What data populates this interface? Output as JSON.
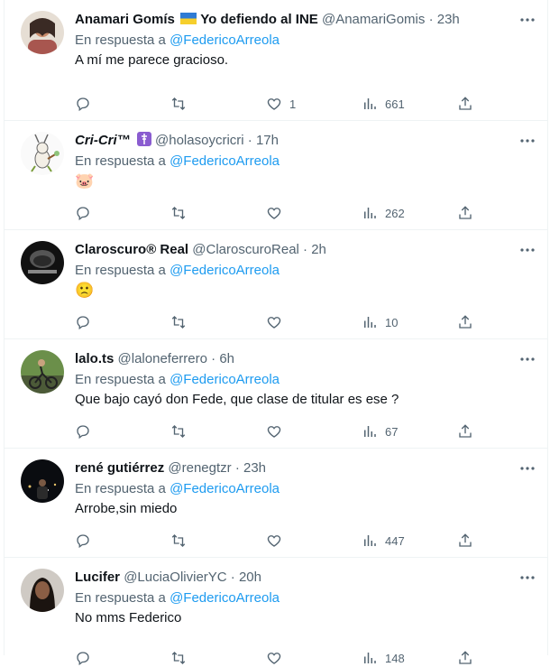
{
  "reply_prefix": "En respuesta a",
  "reply_handle": "@FedericoArreola",
  "tweets": [
    {
      "name": "Anamari Gomís",
      "name_suffix": "Yo defiendo al INE",
      "handle": "@AnamariGomis",
      "time": "23h",
      "text": "A mí me parece gracioso.",
      "likes": "1",
      "views": "661"
    },
    {
      "name": "Cri-Cri™",
      "handle": "@holasoycricri",
      "time": "17h",
      "text": "🐷",
      "likes": "",
      "views": "262"
    },
    {
      "name": "Claroscuro® Real",
      "handle": "@ClaroscuroReal",
      "time": "2h",
      "text": "🙁",
      "likes": "",
      "views": "10"
    },
    {
      "name": "lalo.ts",
      "handle": "@laloneferrero",
      "time": "6h",
      "text": "Que bajo cayó don Fede, que clase de titular es ese ?",
      "likes": "",
      "views": "67"
    },
    {
      "name": "rené gutiérrez",
      "handle": "@renegtzr",
      "time": "23h",
      "text": "Arrobe,sin miedo",
      "likes": "",
      "views": "447"
    },
    {
      "name": "Lucifer",
      "handle": "@LuciaOlivierYC",
      "time": "20h",
      "text": "No mms Federico",
      "likes": "",
      "views": "148"
    }
  ],
  "icons": {
    "reply": "reply-icon",
    "retweet": "retweet-icon",
    "like": "like-icon",
    "views": "views-icon",
    "share": "share-icon",
    "more": "more-icon"
  },
  "colors": {
    "link": "#1d9bf0",
    "muted": "#536471",
    "text": "#0f1419"
  }
}
